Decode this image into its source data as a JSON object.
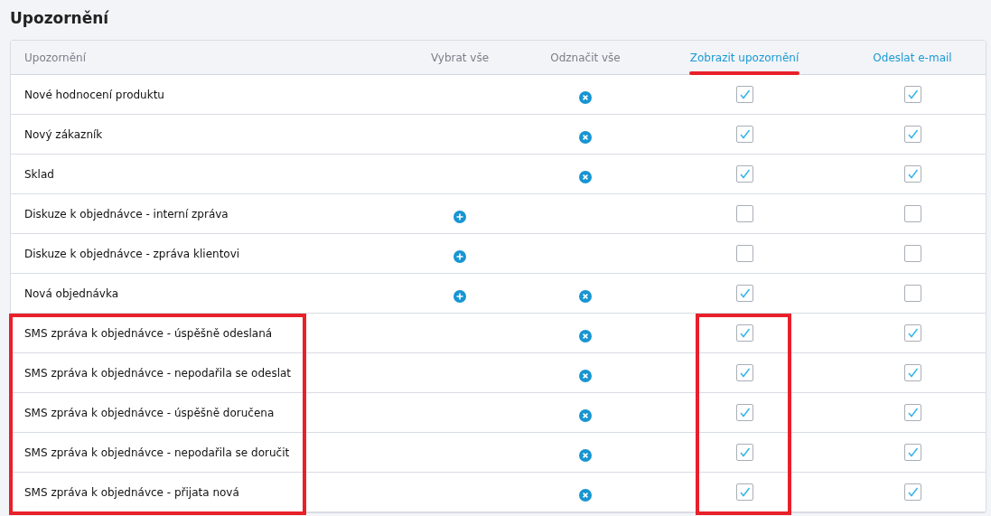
{
  "title": "Upozornění",
  "columns": [
    {
      "label": "Upozornění",
      "kind": "name"
    },
    {
      "label": "Vybrat vše",
      "kind": "plain"
    },
    {
      "label": "Odznačit vše",
      "kind": "plain"
    },
    {
      "label": "Zobrazit upozornění",
      "kind": "link",
      "highlighted": true
    },
    {
      "label": "Odeslat e-mail",
      "kind": "link",
      "highlighted": false
    }
  ],
  "rows": [
    {
      "name": "Nové hodnocení produktu",
      "select": false,
      "deselect": true,
      "show": true,
      "email": true,
      "highlighted": false
    },
    {
      "name": "Nový zákazník",
      "select": false,
      "deselect": true,
      "show": true,
      "email": true,
      "highlighted": false
    },
    {
      "name": "Sklad",
      "select": false,
      "deselect": true,
      "show": true,
      "email": true,
      "highlighted": false
    },
    {
      "name": "Diskuze k objednávce - interní zpráva",
      "select": true,
      "deselect": false,
      "show": false,
      "email": false,
      "highlighted": false
    },
    {
      "name": "Diskuze k objednávce - zpráva klientovi",
      "select": true,
      "deselect": false,
      "show": false,
      "email": false,
      "highlighted": false
    },
    {
      "name": "Nová objednávka",
      "select": true,
      "deselect": true,
      "show": true,
      "email": false,
      "highlighted": false
    },
    {
      "name": "SMS zpráva k objednávce - úspěšně odeslaná",
      "select": false,
      "deselect": true,
      "show": true,
      "email": true,
      "highlighted": true
    },
    {
      "name": "SMS zpráva k objednávce - nepodařila se odeslat",
      "select": false,
      "deselect": true,
      "show": true,
      "email": true,
      "highlighted": true
    },
    {
      "name": "SMS zpráva k objednávce - úspěšně doručena",
      "select": false,
      "deselect": true,
      "show": true,
      "email": true,
      "highlighted": true
    },
    {
      "name": "SMS zpráva k objednávce - nepodařila se doručit",
      "select": false,
      "deselect": true,
      "show": true,
      "email": true,
      "highlighted": true
    },
    {
      "name": "SMS zpráva k objednávce - přijata nová",
      "select": false,
      "deselect": true,
      "show": true,
      "email": true,
      "highlighted": true
    }
  ]
}
